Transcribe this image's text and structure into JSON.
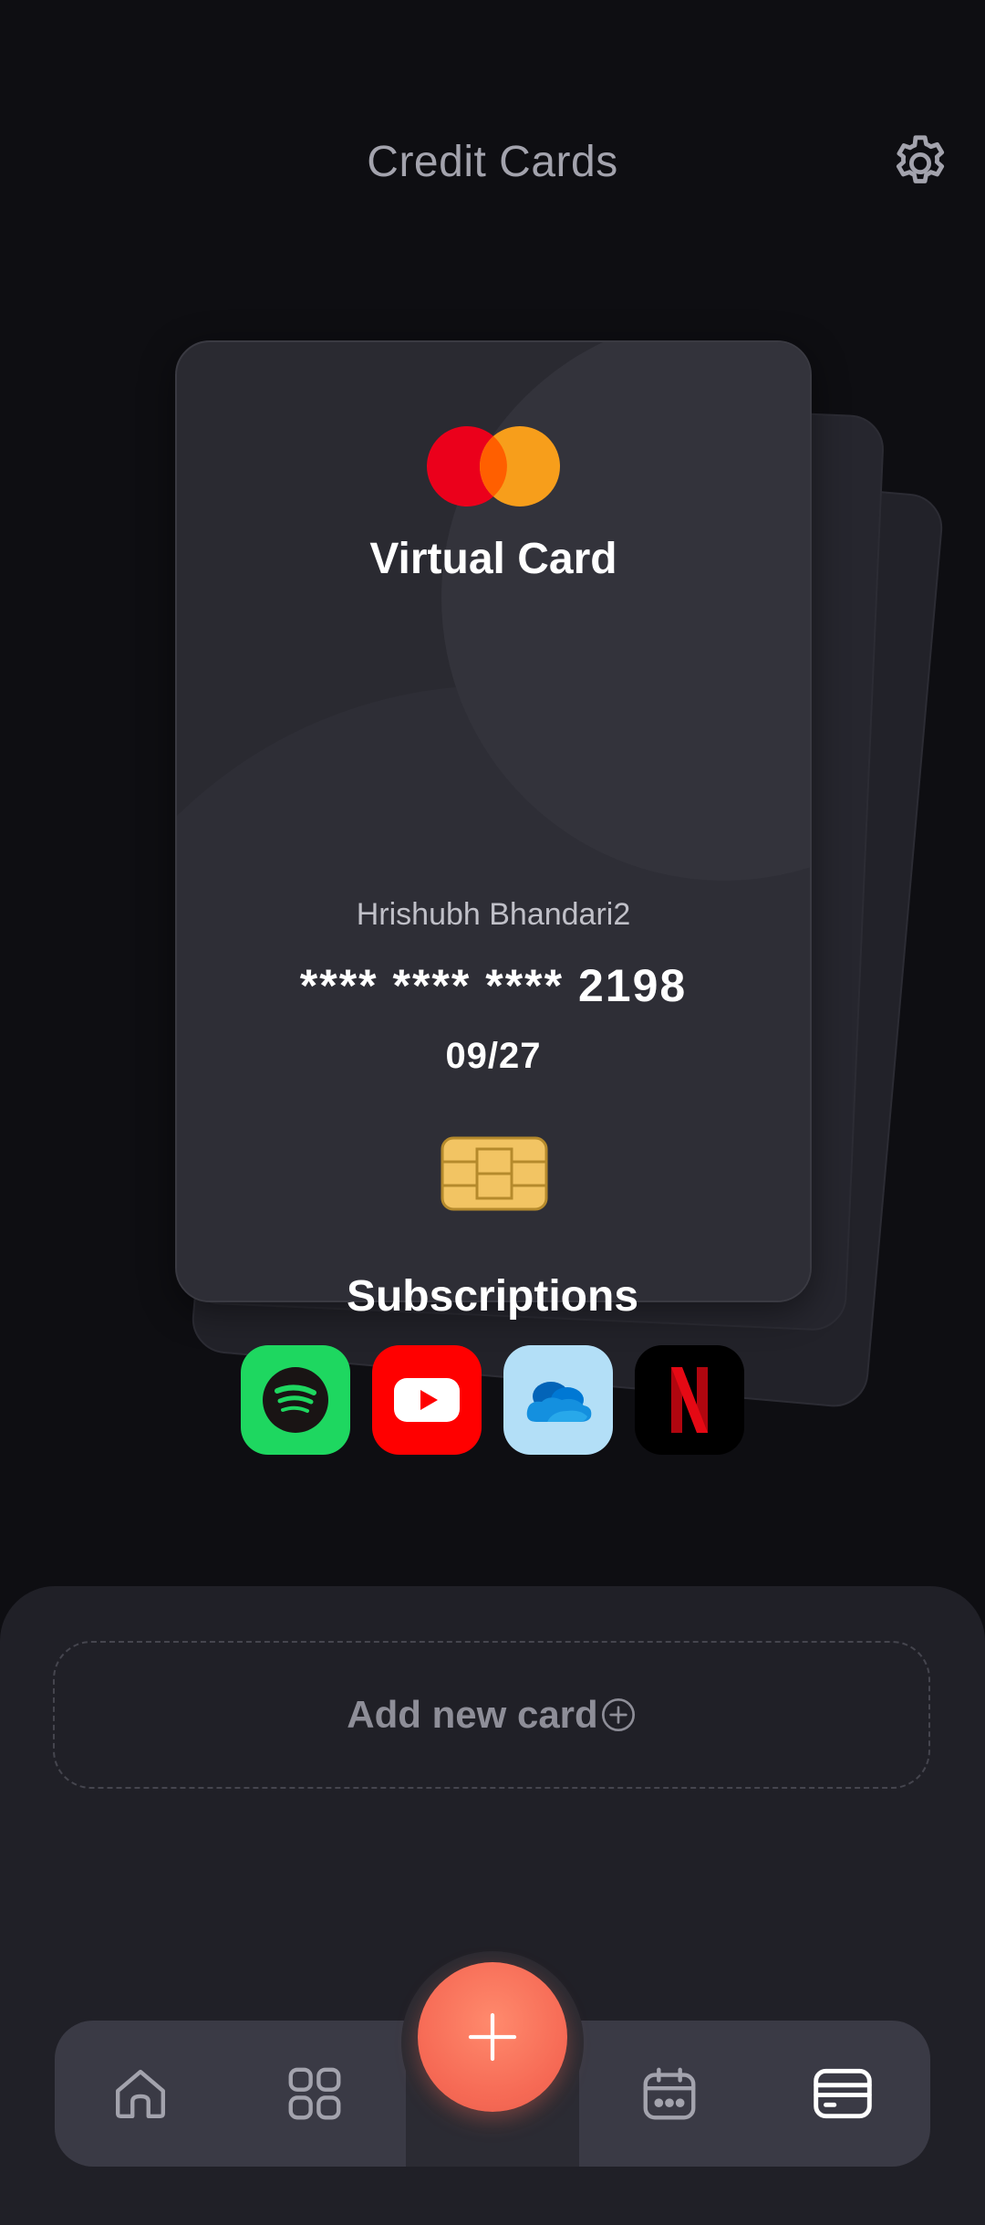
{
  "header": {
    "title": "Credit Cards",
    "settings_icon": "gear-icon"
  },
  "card": {
    "type_label": "Virtual Card",
    "brand_icon": "mastercard-logo",
    "holder_name": "Hrishubh Bhandari2",
    "number": "**** **** **** 2198",
    "expiry": "09/27",
    "chip_icon": "chip-icon"
  },
  "subscriptions": {
    "title": "Subscriptions",
    "apps": [
      {
        "icon": "spotify-icon",
        "color": "#1ed760"
      },
      {
        "icon": "youtube-icon",
        "color": "#ff0000"
      },
      {
        "icon": "onedrive-icon",
        "color": "#b3dff7"
      },
      {
        "icon": "netflix-icon",
        "color": "#000000"
      }
    ]
  },
  "add_card": {
    "label": "Add new card",
    "icon": "plus-circle-icon"
  },
  "nav": {
    "items": [
      {
        "icon": "home-icon"
      },
      {
        "icon": "grid-icon"
      },
      {
        "icon": "add-icon"
      },
      {
        "icon": "calendar-icon"
      },
      {
        "icon": "wallet-icon",
        "active": true
      }
    ]
  },
  "colors": {
    "accent": "#f66a55",
    "background": "#0e0e12",
    "panel": "#202027"
  }
}
